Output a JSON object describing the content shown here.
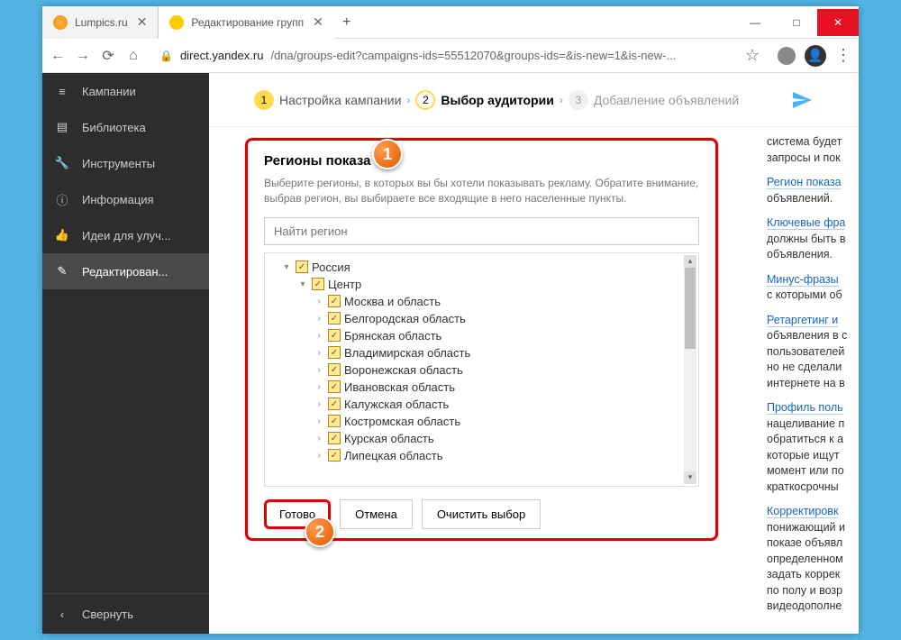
{
  "window": {
    "minimize": "—",
    "maximize": "□",
    "close": "✕"
  },
  "tabs": [
    {
      "title": "Lumpics.ru",
      "close": "✕"
    },
    {
      "title": "Редактирование групп",
      "close": "✕"
    }
  ],
  "newtab": "+",
  "addressbar": {
    "back": "←",
    "forward": "→",
    "reload": "⟳",
    "home": "⌂",
    "lock": "🔒",
    "host": "direct.yandex.ru",
    "path": "/dna/groups-edit?campaigns-ids=55512070&groups-ids=&is-new=1&is-new-...",
    "star": "☆",
    "menu": "⋮"
  },
  "sidebar": {
    "items": [
      {
        "icon": "≡",
        "label": "Кампании"
      },
      {
        "icon": "▤",
        "label": "Библиотека"
      },
      {
        "icon": "🔧",
        "label": "Инструменты"
      },
      {
        "icon": "ⓘ",
        "label": "Информация"
      },
      {
        "icon": "👍",
        "label": "Идеи для улуч..."
      },
      {
        "icon": "✎",
        "label": "Редактирован..."
      }
    ],
    "collapse": {
      "icon": "‹",
      "label": "Свернуть"
    }
  },
  "steps": {
    "s1": {
      "num": "1",
      "label": "Настройка кампании"
    },
    "s2": {
      "num": "2",
      "label": "Выбор аудитории"
    },
    "s3": {
      "num": "3",
      "label": "Добавление объявлений"
    },
    "arrow": "›"
  },
  "dialog": {
    "title": "Регионы показа",
    "desc": "Выберите регионы, в которых вы бы хотели показывать рекламу. Обратите внимание, выбрав регион, вы выбираете все входящие в него населенные пункты.",
    "search_placeholder": "Найти регион",
    "tree": [
      {
        "indent": 1,
        "toggle": "▾",
        "label": "Россия"
      },
      {
        "indent": 2,
        "toggle": "▾",
        "label": "Центр"
      },
      {
        "indent": 3,
        "toggle": "›",
        "label": "Москва и область"
      },
      {
        "indent": 3,
        "toggle": "›",
        "label": "Белгородская область"
      },
      {
        "indent": 3,
        "toggle": "›",
        "label": "Брянская область"
      },
      {
        "indent": 3,
        "toggle": "›",
        "label": "Владимирская область"
      },
      {
        "indent": 3,
        "toggle": "›",
        "label": "Воронежская область"
      },
      {
        "indent": 3,
        "toggle": "›",
        "label": "Ивановская область"
      },
      {
        "indent": 3,
        "toggle": "›",
        "label": "Калужская область"
      },
      {
        "indent": 3,
        "toggle": "›",
        "label": "Костромская область"
      },
      {
        "indent": 3,
        "toggle": "›",
        "label": "Курская область"
      },
      {
        "indent": 3,
        "toggle": "›",
        "label": "Липецкая область"
      }
    ],
    "check": "✓",
    "actions": {
      "done": "Готово",
      "cancel": "Отмена",
      "clear": "Очистить выбор"
    }
  },
  "rightpanel": {
    "p1a": "система будет",
    "p1b": "запросы и пок",
    "l2": "Регион показа",
    "p2": "объявлений.",
    "l3": "Ключевые фра",
    "p3a": "должны быть в",
    "p3b": "объявления.",
    "l4": "Минус-фразы",
    "p4": "с которыми об",
    "l5": "Ретаргетинг и",
    "p5a": "объявления в с",
    "p5b": "пользователей",
    "p5c": "но не сделали",
    "p5d": "интернете на в",
    "l6": "Профиль поль",
    "p6a": "нацеливание п",
    "p6b": "обратиться к а",
    "p6c": "которые ищут",
    "p6d": "момент или по",
    "p6e": "краткосрочны",
    "l7": "Корректировк",
    "p7a": "понижающий и",
    "p7b": "показе объявл",
    "p7c": "определенном",
    "p7d": "задать коррек",
    "p7e": "по полу и возр",
    "p7f": "видеодополне"
  },
  "callouts": {
    "one": "1",
    "two": "2"
  }
}
